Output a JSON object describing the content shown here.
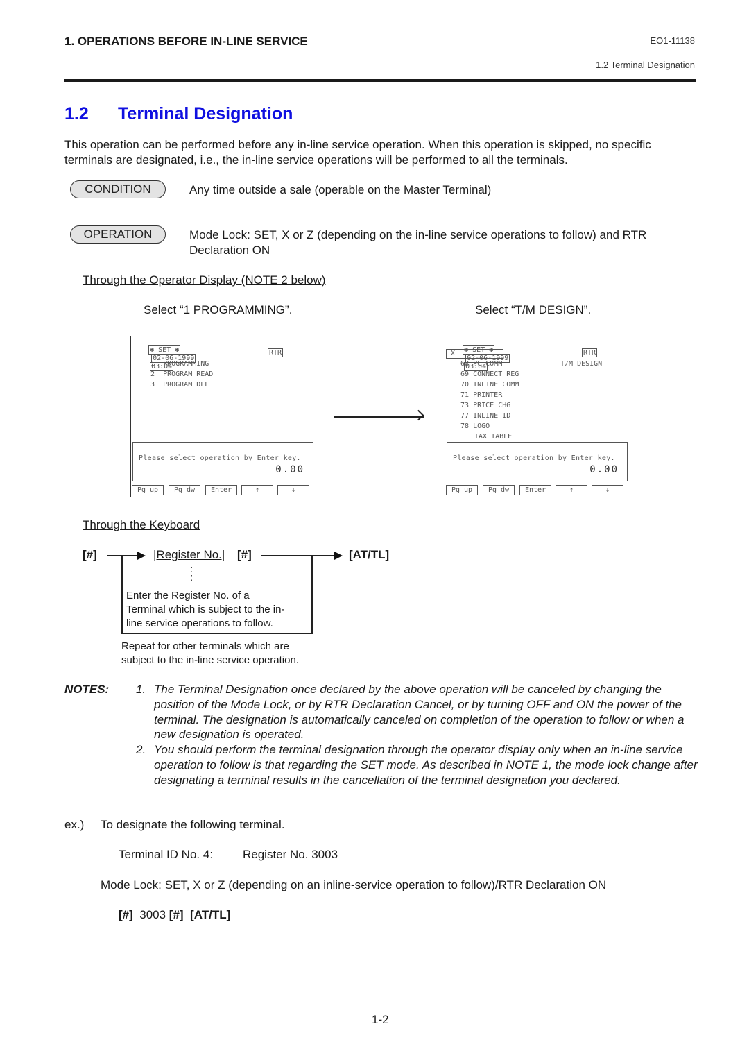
{
  "header": {
    "section": "1.  OPERATIONS BEFORE IN-LINE SERVICE",
    "doc_code": "EO1-11138",
    "subsection": "1.2  Terminal Designation"
  },
  "title": {
    "number": "1.2",
    "text": "Terminal Designation",
    "color": "#1010e0"
  },
  "intro": "This operation can be performed before any in-line service operation. When this operation is skipped, no specific terminals are designated, i.e., the in-line service operations will be performed to all the terminals.",
  "condition": {
    "badge": "CONDITION",
    "text": "Any time outside a sale (operable on the Master Terminal)"
  },
  "operation": {
    "badge": "OPERATION",
    "text": "Mode Lock:  SET, X or Z (depending on the in-line service operations to follow) and RTR Declaration ON"
  },
  "operator_display": {
    "heading": "Through the Operator Display (NOTE 2 below)",
    "step1_caption": "Select “1 PROGRAMMING”.",
    "step2_caption": "Select “T/M DESIGN”.",
    "screen1": {
      "mode": "✱ SET ✱",
      "date": "02-06-1999",
      "time": "03:04",
      "rtr": "RTR",
      "items": [
        {
          "no": "1",
          "label": "PROGRAMMING"
        },
        {
          "no": "2",
          "label": "PROGRAM READ"
        },
        {
          "no": "3",
          "label": "PROGRAM DLL"
        }
      ],
      "message": "Please select operation by Enter key.",
      "value": "0.00",
      "keys": [
        "Pg up",
        "Pg dw",
        "Enter",
        "↑",
        "↓"
      ]
    },
    "screen2": {
      "mode": "✱ SET ✱",
      "date": "02-06-1999",
      "time": "03:04",
      "input": "X",
      "rtr": "RTR",
      "side_label": "T/M DESIGN",
      "items": [
        {
          "no": "68",
          "label": "PC COMM"
        },
        {
          "no": "69",
          "label": "CONNECT REG"
        },
        {
          "no": "70",
          "label": "INLINE COMM"
        },
        {
          "no": "71",
          "label": "PRINTER"
        },
        {
          "no": "73",
          "label": "PRICE CHG"
        },
        {
          "no": "77",
          "label": "INLINE ID"
        },
        {
          "no": "78",
          "label": "LOGO"
        },
        {
          "no": "",
          "label": "TAX TABLE"
        }
      ],
      "message": "Please select operation by Enter key.",
      "value": "0.00",
      "keys": [
        "Pg up",
        "Pg dw",
        "Enter",
        "↑",
        "↓"
      ]
    }
  },
  "keyboard": {
    "heading": "Through the Keyboard",
    "key_start": "[#]",
    "register_no": "|Register No.|",
    "key_hash": "[#]",
    "key_end": "[AT/TL]",
    "dots": ":\n:",
    "box_note": "Enter the Register No. of a Terminal which is subject to the in-line service operations to follow.",
    "box_note_lines": [
      "Enter the Register No. of a",
      "Terminal which is subject to the in-",
      "line service operations to follow."
    ],
    "repeat_note_lines": [
      "Repeat for other terminals which are",
      "subject to the in-line service operation."
    ]
  },
  "notes": {
    "label": "NOTES:",
    "items": [
      {
        "n": "1.",
        "text": "The Terminal Designation once declared by the above operation will be canceled by changing the position of the Mode Lock, or by RTR Declaration Cancel, or by turning OFF and ON the power of the terminal. The designation is automatically canceled on completion of the operation to follow or when a new designation is operated."
      },
      {
        "n": "2.",
        "text": "You should perform the terminal designation through the operator display only when an in-line service operation to follow is that regarding the SET mode. As described in NOTE 1, the mode lock change after designating a terminal results in the cancellation of the terminal designation you declared."
      }
    ]
  },
  "example": {
    "label": "ex.)",
    "intro": "To designate the following terminal.",
    "terminal_id": "Terminal ID No. 4:",
    "register": "Register No. 3003",
    "mode_lock": "Mode Lock:  SET, X or Z (depending on an inline-service operation to follow)/RTR Declaration ON",
    "seq": {
      "k1": "[#]",
      "num": "3003",
      "k2": "[#]",
      "k3": "[AT/TL]"
    }
  },
  "page_number": "1-2"
}
